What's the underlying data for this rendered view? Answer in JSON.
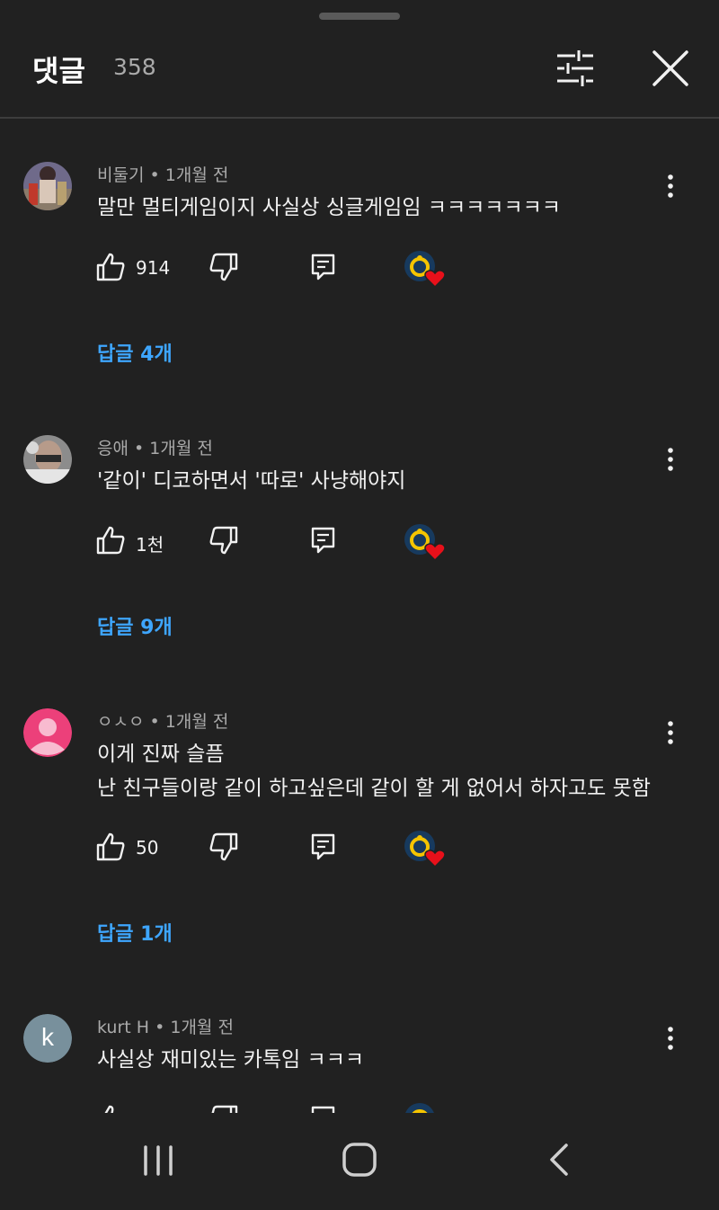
{
  "header": {
    "title": "댓글",
    "count": "358"
  },
  "icons": {
    "filter": "sliders-icon",
    "close": "close-icon"
  },
  "comments": [
    {
      "author": "비둘기",
      "time": "1개월 전",
      "lines": [
        "말만 멀티게임이지 사실상 싱글게임임 ㅋㅋㅋㅋㅋㅋㅋ"
      ],
      "likes": "914",
      "replies": "답글 4개",
      "avatar_type": "image"
    },
    {
      "author": "응애",
      "time": "1개월 전",
      "lines": [
        "'같이' 디코하면서 '따로' 사냥해야지"
      ],
      "likes": "1천",
      "replies": "답글 9개",
      "avatar_type": "image"
    },
    {
      "author": "ㅇㅅㅇ",
      "time": "1개월 전",
      "lines": [
        "이게 진짜 슬픔",
        "난 친구들이랑 같이 하고싶은데 같이 할 게 없어서 하자고도 못함"
      ],
      "likes": "50",
      "replies": "답글 1개",
      "avatar_type": "default-person",
      "avatar_color": "#ec407a"
    },
    {
      "author": "kurt H",
      "time": "1개월 전",
      "lines": [
        "사실상 재미있는 카톡임 ㅋㅋㅋ"
      ],
      "likes": "",
      "replies": "",
      "avatar_type": "letter",
      "avatar_letter": "k",
      "avatar_color": "#78909c"
    }
  ],
  "colors": {
    "background": "#212121",
    "reply_link": "#3ea6ff",
    "heart": "#e8101a",
    "divider": "#3d3d3d"
  },
  "meta_separator": " • "
}
